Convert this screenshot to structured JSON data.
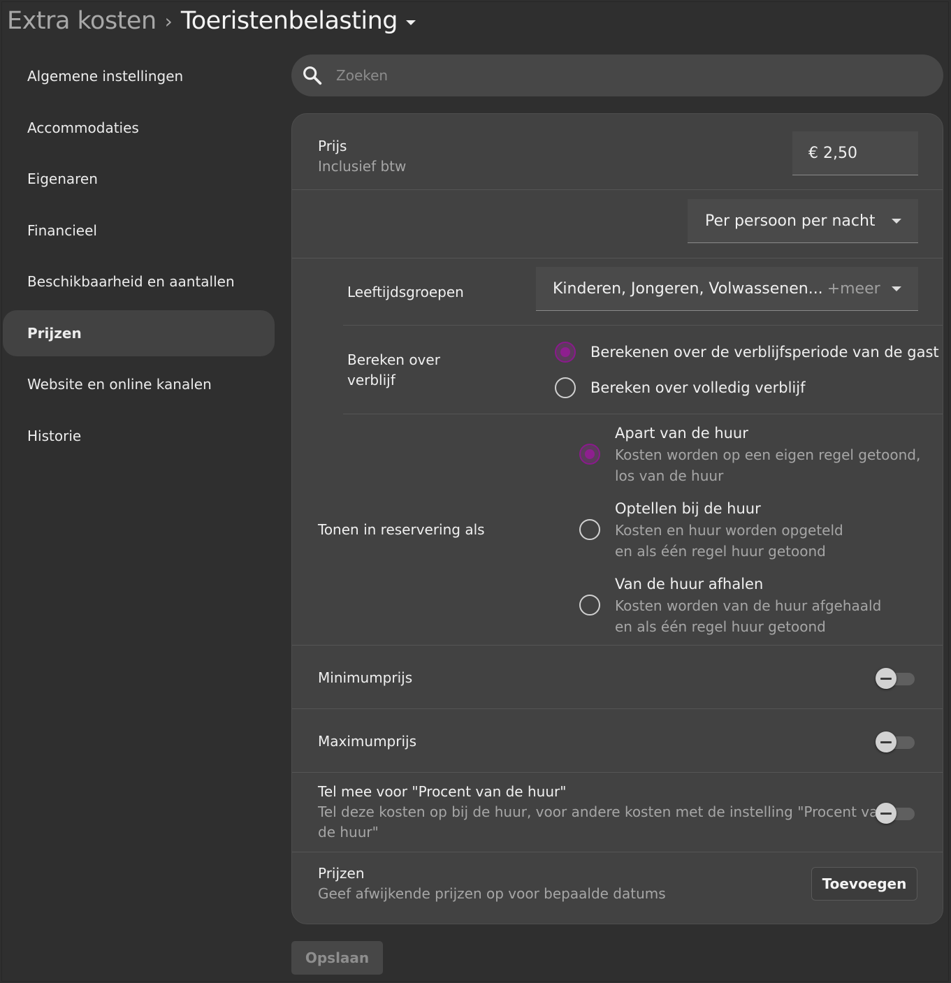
{
  "header": {
    "parent": "Extra kosten",
    "separator": "›",
    "current": "Toeristenbelasting"
  },
  "sidebar": {
    "items": [
      {
        "label": "Algemene instellingen"
      },
      {
        "label": "Accommodaties"
      },
      {
        "label": "Eigenaren"
      },
      {
        "label": "Financieel"
      },
      {
        "label": "Beschikbaarheid en aantallen"
      },
      {
        "label": "Prijzen",
        "active": true
      },
      {
        "label": "Website en online kanalen"
      },
      {
        "label": "Historie"
      }
    ]
  },
  "search": {
    "placeholder": "Zoeken",
    "icon": "search-icon"
  },
  "form": {
    "price": {
      "label": "Prijs",
      "sublabel": "Inclusief btw",
      "value": "€ 2,50"
    },
    "unit": {
      "value": "Per persoon per nacht"
    },
    "age_groups": {
      "label": "Leeftijdsgroepen",
      "value": "Kinderen, Jongeren, Volwassenen...",
      "more": "+meer"
    },
    "calc_over": {
      "label_line1": "Bereken over",
      "label_line2": "verblijf",
      "options": [
        {
          "label": "Berekenen over de verblijfsperiode van de gast",
          "selected": true
        },
        {
          "label": "Bereken over volledig verblijf",
          "selected": false
        }
      ]
    },
    "show_as": {
      "label": "Tonen in reservering als",
      "options": [
        {
          "label": "Apart van de huur",
          "desc_line1": "Kosten worden op een eigen regel getoond,",
          "desc_line2": "los van de huur",
          "selected": true
        },
        {
          "label": "Optellen bij de huur",
          "desc_line1": "Kosten en huur worden opgeteld",
          "desc_line2": "en als één regel huur getoond",
          "selected": false
        },
        {
          "label": "Van de huur afhalen",
          "desc_line1": "Kosten worden van de huur afgehaald",
          "desc_line2": "en als één regel huur getoond",
          "selected": false
        }
      ]
    },
    "min_price": {
      "label": "Minimumprijs",
      "enabled": false
    },
    "max_price": {
      "label": "Maximumprijs",
      "enabled": false
    },
    "count_percent": {
      "label": "Tel mee voor \"Procent van de huur\"",
      "desc_line1": "Tel deze kosten op bij de huur, voor andere kosten met de instelling \"Procent van",
      "desc_line2": "de huur\"",
      "enabled": false
    },
    "prices": {
      "label": "Prijzen",
      "sublabel": "Geef afwijkende prijzen op voor bepaalde datums",
      "add_button": "Toevoegen"
    }
  },
  "footer": {
    "save_button": "Opslaan"
  },
  "colors": {
    "background": "#2f2f2f",
    "card": "#424242",
    "accent": "#8e1f8f"
  }
}
